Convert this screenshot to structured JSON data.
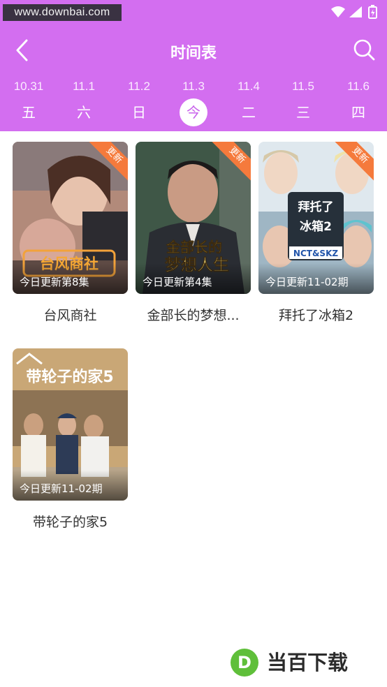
{
  "status_bar": {
    "watermark": "www.downbai.com"
  },
  "app_bar": {
    "title": "时间表"
  },
  "colors": {
    "accent": "#d36ef0",
    "badge": "#f57a3c",
    "text": "#333333"
  },
  "dates": [
    {
      "date": "10.31",
      "weekday": "五",
      "active": false
    },
    {
      "date": "11.1",
      "weekday": "六",
      "active": false
    },
    {
      "date": "11.2",
      "weekday": "日",
      "active": false
    },
    {
      "date": "11.3",
      "weekday": "今",
      "active": true
    },
    {
      "date": "11.4",
      "weekday": "二",
      "active": false
    },
    {
      "date": "11.5",
      "weekday": "三",
      "active": false
    },
    {
      "date": "11.6",
      "weekday": "四",
      "active": false
    }
  ],
  "shows": [
    {
      "title": "台风商社",
      "caption": "今日更新第8集",
      "badge": "更新",
      "poster_text": "台风商社"
    },
    {
      "title": "金部长的梦想...",
      "caption": "今日更新第4集",
      "badge": "更新",
      "poster_text": "金部长的梦想人生"
    },
    {
      "title": "拜托了冰箱2",
      "caption": "今日更新11-02期",
      "badge": "更新",
      "poster_text": "拜托了冰箱2",
      "poster_sub": "NCT&SKZ"
    },
    {
      "title": "带轮子的家5",
      "caption": "今日更新11-02期",
      "badge": "",
      "poster_text": "带轮子的家5"
    }
  ],
  "footer_watermark": "当百下载"
}
